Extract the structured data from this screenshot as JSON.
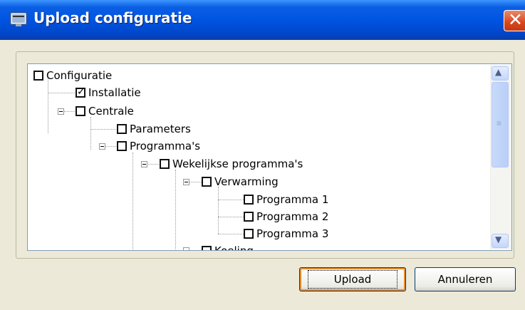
{
  "window": {
    "title": "Upload configuratie",
    "close_symbol": "✕"
  },
  "tree": {
    "nodes": [
      {
        "label": "Configuratie",
        "checked": false
      },
      {
        "label": "Installatie",
        "checked": true
      },
      {
        "label": "Centrale",
        "checked": false
      },
      {
        "label": "Parameters",
        "checked": false
      },
      {
        "label": "Programma's",
        "checked": false
      },
      {
        "label": "Wekelijkse programma's",
        "checked": false
      },
      {
        "label": "Verwarming",
        "checked": false
      },
      {
        "label": "Programma 1",
        "checked": false
      },
      {
        "label": "Programma 2",
        "checked": false
      },
      {
        "label": "Programma 3",
        "checked": false
      },
      {
        "label": "Koeling",
        "checked": false
      }
    ]
  },
  "scrollbar": {
    "up_arrow": "▲",
    "down_arrow": "▼",
    "grip": "≡"
  },
  "buttons": {
    "upload": "Upload",
    "cancel": "Annuleren"
  },
  "colors": {
    "titlebar": "#0054e3",
    "close": "#d9461e",
    "default_focus": "#e88a2c",
    "face": "#ece9d8"
  }
}
